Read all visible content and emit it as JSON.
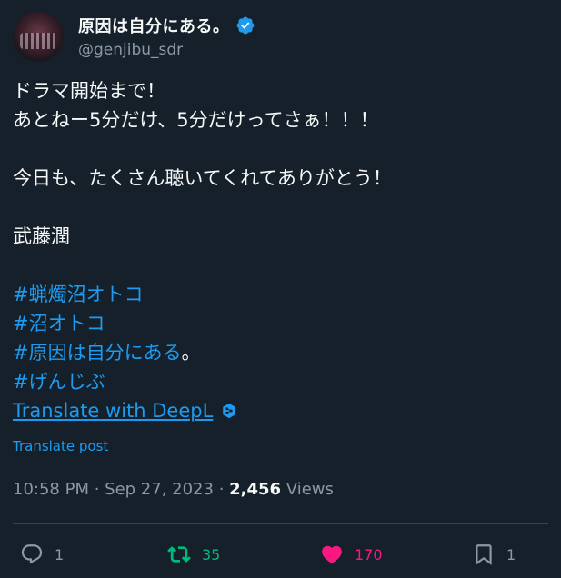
{
  "user": {
    "display_name": "原因は自分にある。",
    "handle": "@genjibu_sdr",
    "verified": true
  },
  "tweet": {
    "lines": [
      "ドラマ開始まで！",
      "あとねー5分だけ、5分だけってさぁ！！！",
      "今日も、たくさん聴いてくれてありがとう！",
      "武藤潤"
    ],
    "hashtags": [
      "#蝋燭沼オトコ",
      "#沼オトコ",
      "#原因は自分にある",
      "#げんじぶ"
    ],
    "hashtag_suffix": "。",
    "deepl_link": "Translate with DeepL",
    "translate_post": "Translate post"
  },
  "meta": {
    "time": "10:58 PM",
    "sep1": " · ",
    "date": "Sep 27, 2023",
    "sep2": " · ",
    "views_count": "2,456",
    "views_label": " Views"
  },
  "actions": {
    "replies": "1",
    "retweets": "35",
    "likes": "170",
    "bookmarks": "1"
  },
  "colors": {
    "background": "#15202b",
    "link": "#1d9bf0",
    "retweet": "#00ba7c",
    "like": "#f91880",
    "muted": "#8b98a5"
  },
  "icons": [
    "verified-badge-icon",
    "deepl-icon",
    "reply-icon",
    "retweet-icon",
    "heart-icon",
    "bookmark-icon"
  ]
}
